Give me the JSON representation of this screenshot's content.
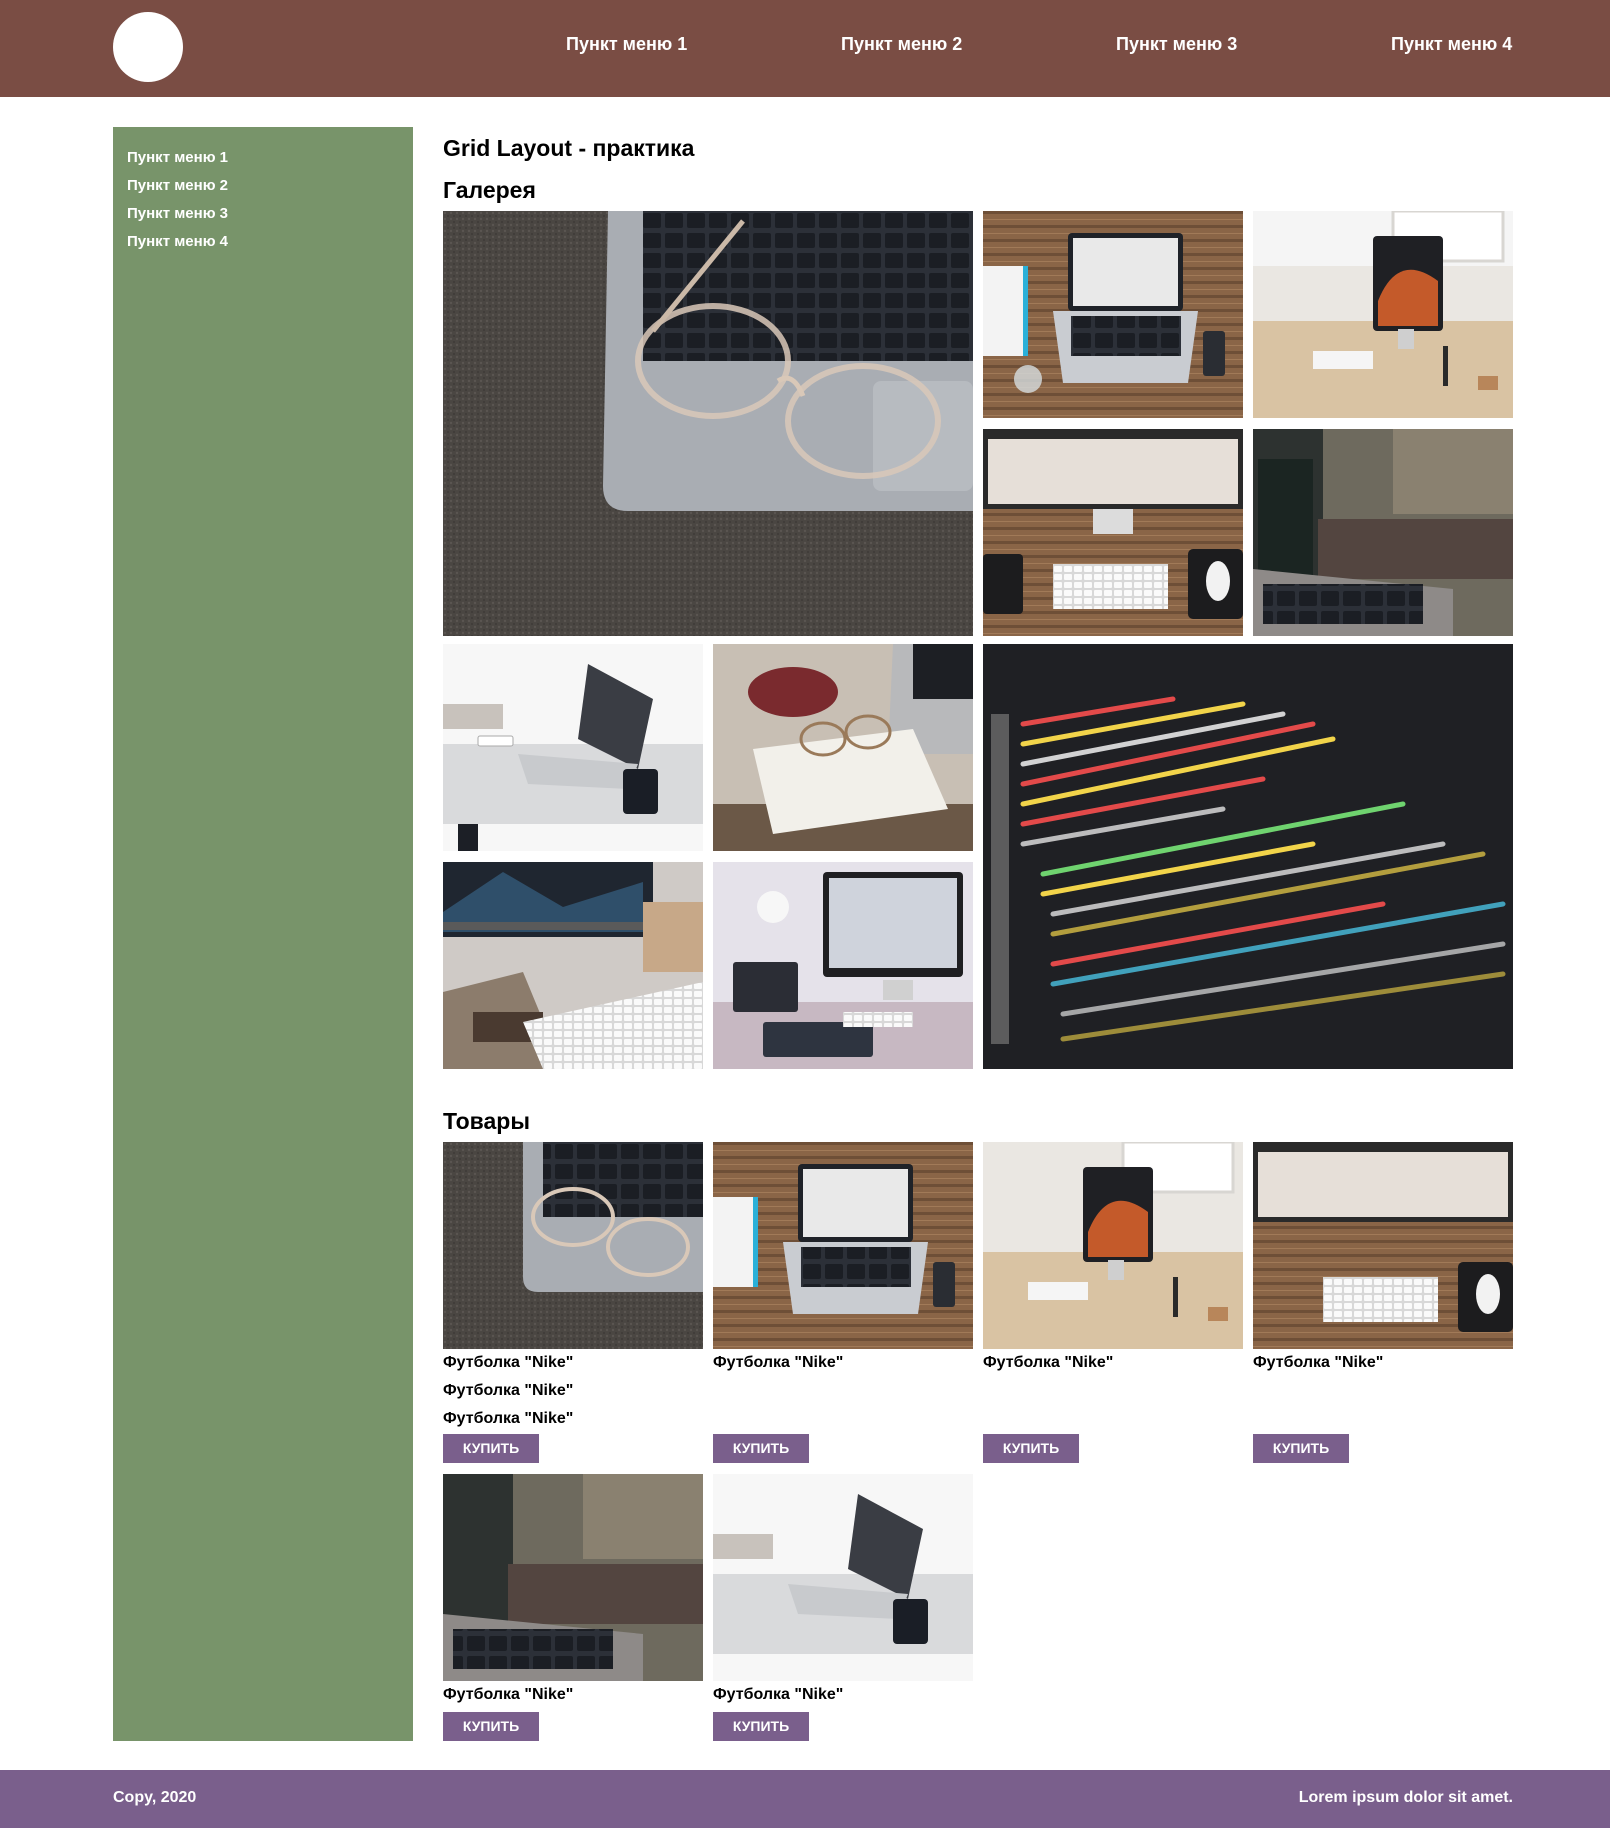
{
  "header": {
    "nav": [
      "Пункт меню 1",
      "Пункт меню 2",
      "Пункт меню 3",
      "Пункт меню 4"
    ]
  },
  "sidebar": {
    "items": [
      "Пункт меню 1",
      "Пункт меню 2",
      "Пункт меню 3",
      "Пункт меню 4"
    ]
  },
  "main": {
    "title": "Grid Layout - практика",
    "gallery_title": "Галерея",
    "products_title": "Товары"
  },
  "products": [
    {
      "names": [
        "Футболка \"Nike\"",
        "Футболка \"Nike\"",
        "Футболка \"Nike\""
      ],
      "button": "Купить"
    },
    {
      "names": [
        "Футболка \"Nike\""
      ],
      "button": "Купить"
    },
    {
      "names": [
        "Футболка \"Nike\""
      ],
      "button": "Купить"
    },
    {
      "names": [
        "Футболка \"Nike\""
      ],
      "button": "Купить"
    },
    {
      "names": [
        "Футболка \"Nike\""
      ],
      "button": "Купить"
    },
    {
      "names": [
        "Футболка \"Nike\""
      ],
      "button": "Купить"
    }
  ],
  "footer": {
    "copy": "Copy, 2020",
    "text": "Lorem ipsum dolor sit amet."
  },
  "colors": {
    "header": "#7a4d44",
    "sidebar": "#78946a",
    "footer": "#7a5f8c",
    "button": "#7a5f8c"
  }
}
